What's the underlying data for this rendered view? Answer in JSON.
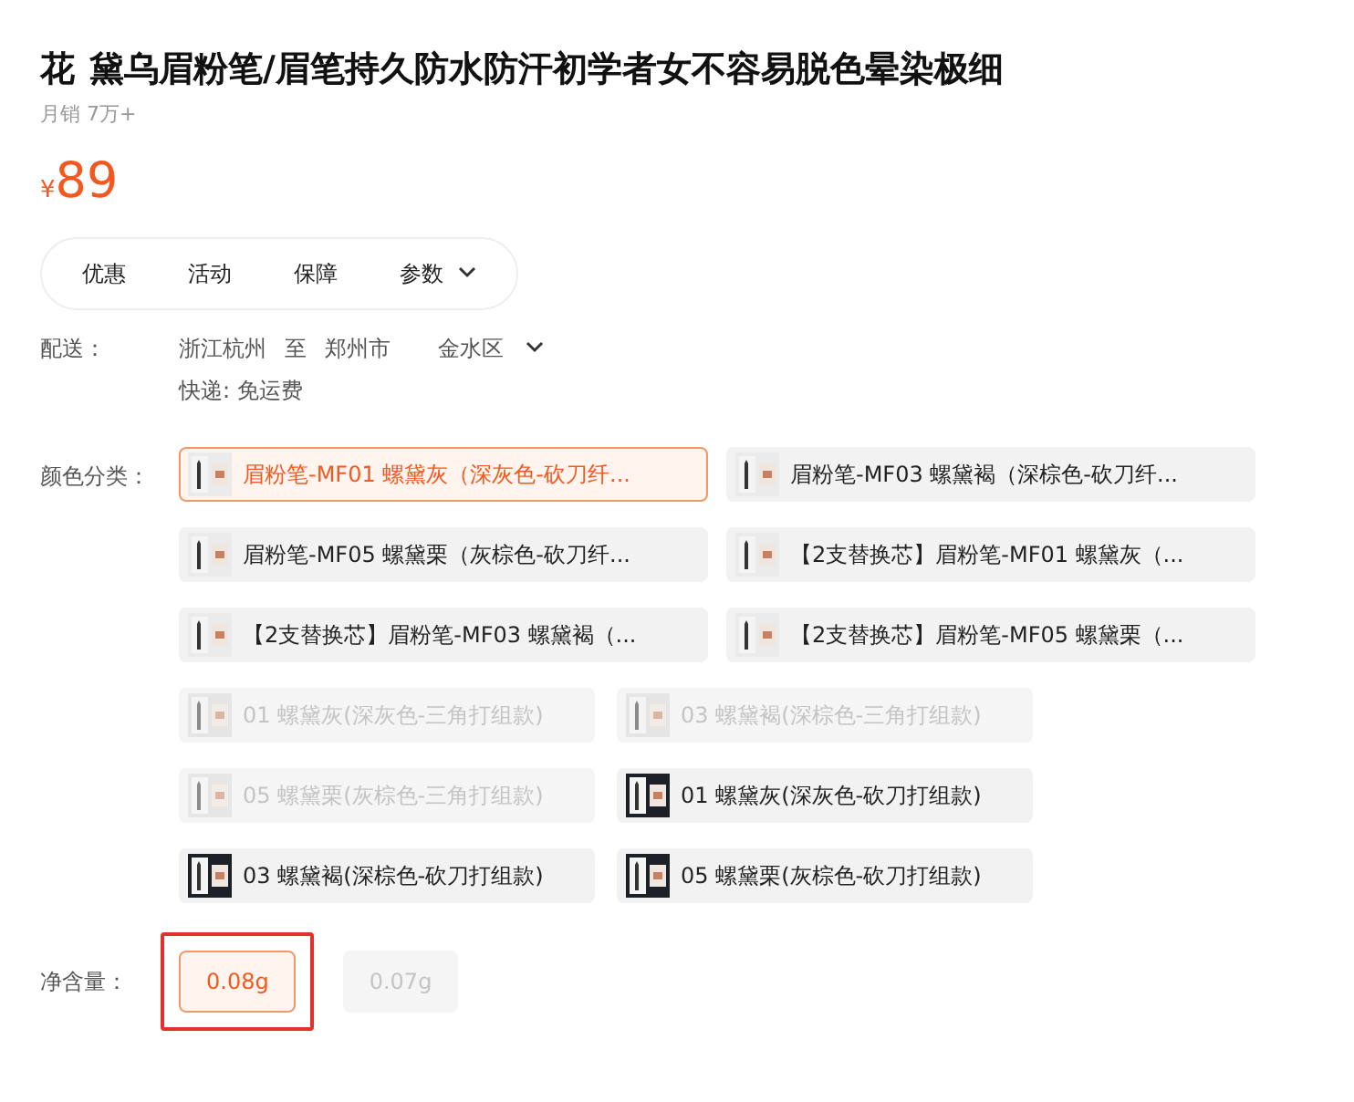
{
  "title": {
    "visible_start": "花",
    "rest": "黛乌眉粉笔/眉笔持久防水防汗初学者女不容易脱色晕染极细"
  },
  "monthly_sales": "月销 7万+",
  "price": {
    "currency": "¥",
    "amount": "89"
  },
  "tabs": [
    {
      "label": "优惠",
      "dropdown": false
    },
    {
      "label": "活动",
      "dropdown": false
    },
    {
      "label": "保障",
      "dropdown": false
    },
    {
      "label": "参数",
      "dropdown": true
    }
  ],
  "delivery": {
    "label": "配送：",
    "from": "浙江杭州",
    "to_word": "至",
    "city": "郑州市",
    "district": "金水区",
    "shipping": "快递: 免运费"
  },
  "color_options": {
    "label": "颜色分类：",
    "wide": [
      {
        "text": "眉粉笔-MF01 螺黛灰（深灰色-砍刀纤...",
        "selected": true,
        "disabled": false
      },
      {
        "text": "眉粉笔-MF03 螺黛褐（深棕色-砍刀纤...",
        "selected": false,
        "disabled": false
      },
      {
        "text": "眉粉笔-MF05 螺黛栗（灰棕色-砍刀纤...",
        "selected": false,
        "disabled": false
      },
      {
        "text": "【2支替换芯】眉粉笔-MF01 螺黛灰（...",
        "selected": false,
        "disabled": false
      },
      {
        "text": "【2支替换芯】眉粉笔-MF03 螺黛褐（...",
        "selected": false,
        "disabled": false
      },
      {
        "text": "【2支替换芯】眉粉笔-MF05 螺黛栗（...",
        "selected": false,
        "disabled": false
      }
    ],
    "narrow": [
      {
        "text": "01 螺黛灰(深灰色-三角打组款)",
        "selected": false,
        "disabled": true,
        "kind": "light"
      },
      {
        "text": "03 螺黛褐(深棕色-三角打组款)",
        "selected": false,
        "disabled": true,
        "kind": "light"
      },
      {
        "text": "05 螺黛栗(灰棕色-三角打组款)",
        "selected": false,
        "disabled": true,
        "kind": "light"
      },
      {
        "text": "01 螺黛灰(深灰色-砍刀打组款)",
        "selected": false,
        "disabled": false,
        "kind": "dark"
      },
      {
        "text": "03 螺黛褐(深棕色-砍刀打组款)",
        "selected": false,
        "disabled": false,
        "kind": "dark"
      },
      {
        "text": "05 螺黛栗(灰棕色-砍刀打组款)",
        "selected": false,
        "disabled": false,
        "kind": "dark"
      }
    ]
  },
  "net_content": {
    "label": "净含量：",
    "options": [
      {
        "text": "0.08g",
        "selected": true,
        "disabled": false,
        "highlighted": true
      },
      {
        "text": "0.07g",
        "selected": false,
        "disabled": true,
        "highlighted": false
      }
    ]
  }
}
